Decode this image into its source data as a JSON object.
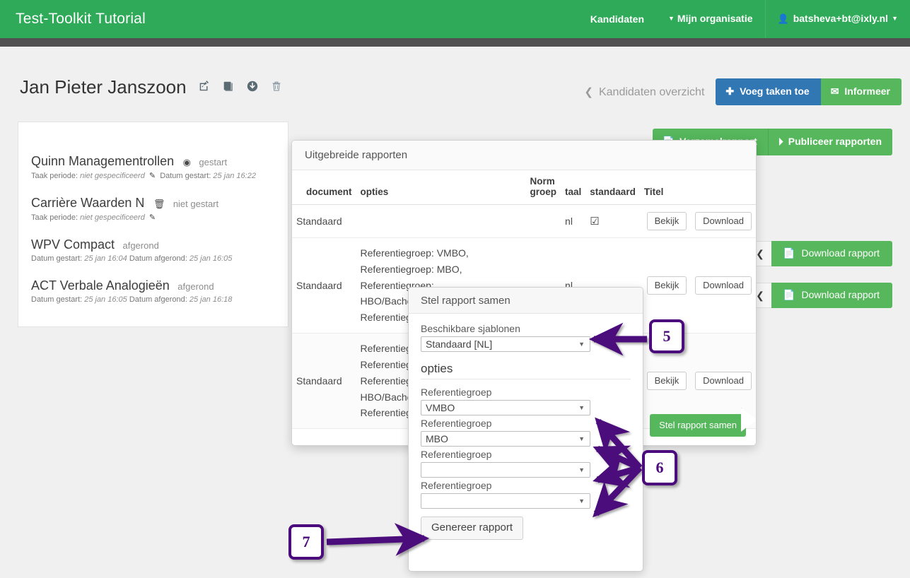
{
  "navbar": {
    "brand": "Test-Toolkit Tutorial",
    "links": [
      {
        "label": "Kandidaten",
        "caret": false
      },
      {
        "label": "Mijn organisatie",
        "caret": true
      }
    ],
    "user": {
      "label": "batsheva+bt@ixly.nl",
      "icon": "user-icon"
    },
    "color": "#2faa58"
  },
  "page": {
    "title": "Jan Pieter Janszoon",
    "title_icons": [
      "edit-icon",
      "copy-icon",
      "download-circle-icon",
      "trash-icon"
    ],
    "back_link": "Kandidaten overzicht",
    "buttons": {
      "add_tasks": {
        "label": "Voeg taken toe",
        "icon": "plus-icon",
        "color": "#3177b4"
      },
      "inform": {
        "label": "Informeer",
        "icon": "envelope-icon",
        "color": "#56b75c"
      }
    }
  },
  "report_actions": {
    "collect": {
      "label": "Verzamelrapport",
      "icon": "file-icon"
    },
    "publish": {
      "label": "Publiceer rapporten",
      "icon": "publish-icon"
    }
  },
  "tasks": [
    {
      "title": "Quinn Managementrollen",
      "icon": "clock-icon",
      "status": "gestart",
      "meta_prefix": "Taak periode:",
      "meta_value": "niet gespecificeerd",
      "meta_edit_icon": "edit-icon",
      "meta_suffix": "Datum gestart:",
      "meta_suffix_value": "25 jan 16:22"
    },
    {
      "title": "Carrière Waarden N",
      "icon": "trash-icon",
      "status": "niet gestart",
      "meta_prefix": "Taak periode:",
      "meta_value": "niet gespecificeerd",
      "meta_edit_icon": "edit-icon",
      "meta_suffix": "",
      "meta_suffix_value": ""
    },
    {
      "title": "WPV Compact",
      "icon": "",
      "status": "afgerond",
      "meta_prefix": "Datum gestart:",
      "meta_value": "25 jan 16:04",
      "meta_edit_icon": "",
      "meta_suffix": "Datum afgerond:",
      "meta_suffix_value": "25 jan 16:05"
    },
    {
      "title": "ACT Verbale Analogieën",
      "icon": "",
      "status": "afgerond",
      "meta_prefix": "Datum gestart:",
      "meta_value": "25 jan 16:05",
      "meta_edit_icon": "",
      "meta_suffix": "Datum afgerond:",
      "meta_suffix_value": "25 jan 16:18"
    }
  ],
  "download_rows": [
    {
      "chevron": "chevron-left-icon",
      "label": "Download rapport",
      "icon": "file-icon"
    },
    {
      "chevron": "chevron-left-icon",
      "label": "Download rapport",
      "icon": "file-icon"
    }
  ],
  "modal": {
    "title": "Uitgebreide rapporten",
    "columns": [
      "document",
      "opties",
      "Norm groep",
      "taal",
      "standaard",
      "Titel"
    ],
    "columns_split": {
      "norm": "Norm",
      "groep": "groep"
    },
    "rows": [
      {
        "document": "Standaard",
        "opties": "",
        "norm_groep": "",
        "taal": "nl",
        "standaard": "checked",
        "titel": "",
        "view": "Bekijk",
        "download": "Download"
      },
      {
        "document": "Standaard",
        "opties": "Referentiegroep: VMBO,\nReferentiegroep: MBO,\nReferentiegroep:\nHBO/Bachelor,\nReferentiegroep:",
        "norm_groep": "",
        "taal": "nl",
        "standaard": "",
        "titel": "",
        "view": "Bekijk",
        "download": "Download"
      },
      {
        "document": "Standaard",
        "opties": "Referentiegroep:\nReferentiegroep:\nReferentiegroep:\nHBO/Bachelor,\nReferentiegroep:",
        "norm_groep": "",
        "taal": "",
        "standaard": "",
        "titel": "",
        "view": "Bekijk",
        "download": "Download"
      }
    ],
    "footer_button": "Stel rapport samen"
  },
  "popover": {
    "title": "Stel rapport samen",
    "templates_label": "Beschikbare sjablonen",
    "template_value": "Standaard [NL]",
    "options_heading": "opties",
    "reference_groups": [
      {
        "label": "Referentiegroep",
        "value": "VMBO"
      },
      {
        "label": "Referentiegroep",
        "value": "MBO"
      },
      {
        "label": "Referentiegroep",
        "value": ""
      },
      {
        "label": "Referentiegroep",
        "value": ""
      }
    ],
    "generate_button": "Genereer rapport"
  },
  "annotations": {
    "accent_color": "#4b0b7c",
    "callouts": [
      {
        "number": "5"
      },
      {
        "number": "6"
      },
      {
        "number": "7"
      }
    ]
  }
}
